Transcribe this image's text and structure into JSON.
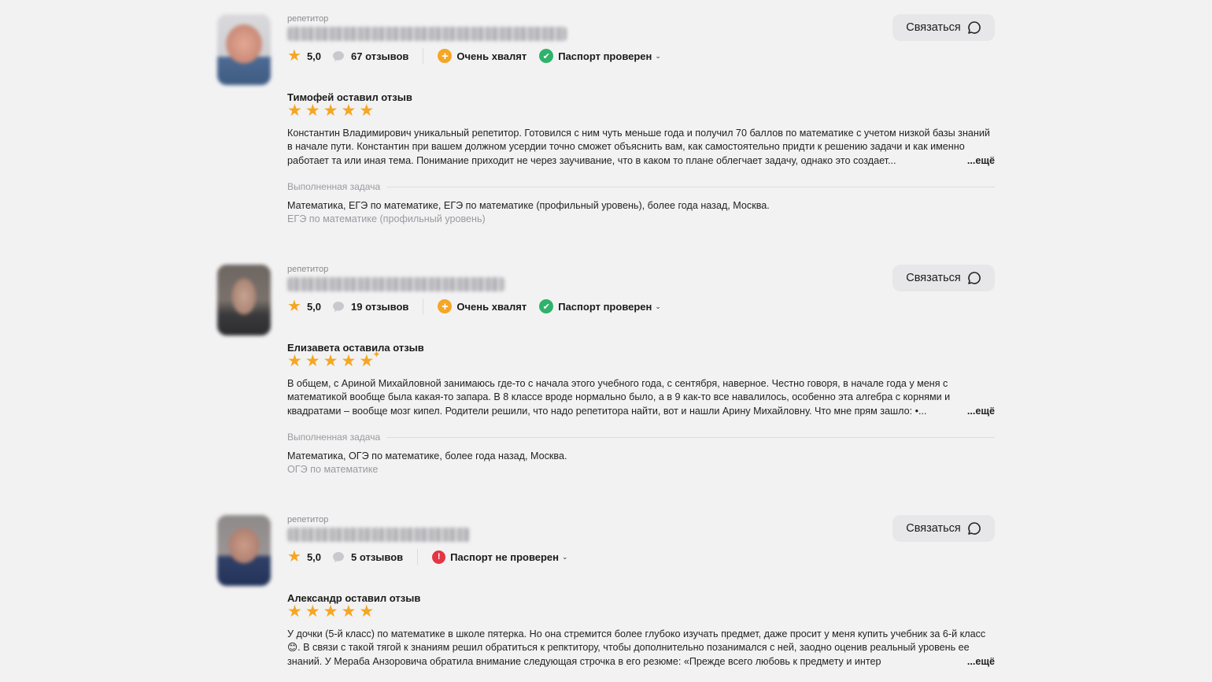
{
  "labels": {
    "role": "репетитор",
    "contact": "Связаться",
    "more": "...ещё",
    "task_heading": "Выполненная задача"
  },
  "cards": [
    {
      "rating": "5,0",
      "reviews_count": "67 отзывов",
      "praise": "Очень хвалят",
      "passport": "Паспорт проверен",
      "passport_verified": true,
      "reviewer": "Тимофей оставил отзыв",
      "review_stars": 5,
      "review_text": "Константин Владимирович уникальный репетитор. Готовился с ним чуть меньше года и получил 70 баллов по математике с учетом низкой базы знаний в начале пути. Константин при вашем должном усердии точно сможет объяснить вам, как самостоятельно придти к решению задачи и как именно работает та или иная тема. Понимание приходит не через заучивание, что в каком то плане облегчает задачу, однако это создает...",
      "task": "Математика, ЕГЭ по математике, ЕГЭ по математике (профильный уровень), более года назад, Москва.",
      "task_sub": "ЕГЭ по математике (профильный уровень)"
    },
    {
      "rating": "5,0",
      "reviews_count": "19 отзывов",
      "praise": "Очень хвалят",
      "passport": "Паспорт проверен",
      "passport_verified": true,
      "reviewer": "Елизавета оставила отзыв",
      "review_stars": 5,
      "review_text": "В общем, с Ариной Михайловной занимаюсь где-то с начала этого учебного года, с сентября, наверное. Честно говоря, в начале года у меня с математикой вообще была какая-то запара. В 8 классе вроде нормально было, а в 9 как-то все навалилось, особенно эта алгебра с корнями и квадратами – вообще мозг кипел. Родители решили, что надо репетитора найти, вот и нашли Арину Михайловну. Что мне прям зашло: •...",
      "task": "Математика, ОГЭ по математике, более года назад, Москва.",
      "task_sub": "ОГЭ по математике"
    },
    {
      "rating": "5,0",
      "reviews_count": "5 отзывов",
      "praise": "",
      "passport": "Паспорт не проверен",
      "passport_verified": false,
      "reviewer": "Александр оставил отзыв",
      "review_stars": 5,
      "review_text": "У дочки (5-й класс) по математике в школе пятерка. Но она стремится более глубоко изучать предмет, даже просит у меня купить учебник за 6-й класс😊. В связи с такой тягой к знаниям решил обратиться к репктитору, чтобы дополнительно позанимался с ней, заодно оценив реальный уровень ее знаний. У Мераба Анзоровича обратила внимание следующая строчка в его резюме: «Прежде всего любовь к предмету и интер",
      "task": "",
      "task_sub": ""
    }
  ]
}
